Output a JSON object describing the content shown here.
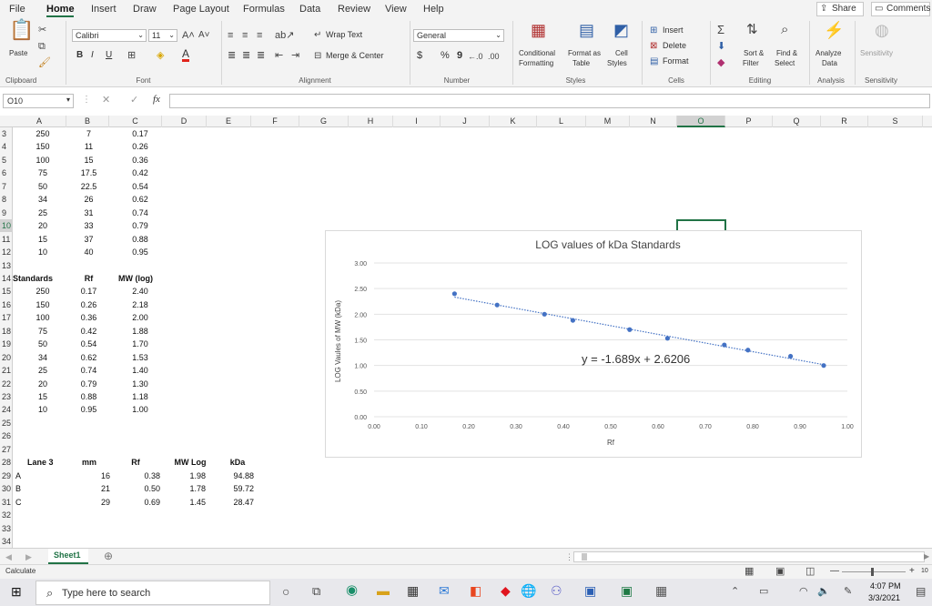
{
  "menu": {
    "tabs": [
      "File",
      "Home",
      "Insert",
      "Draw",
      "Page Layout",
      "Formulas",
      "Data",
      "Review",
      "View",
      "Help"
    ],
    "share_label": "Share",
    "comments_label": "Comments"
  },
  "ribbon": {
    "clipboard": {
      "paste": "Paste",
      "label": "Clipboard"
    },
    "font": {
      "name": "Calibri",
      "size": "11",
      "label": "Font",
      "bold": "B",
      "italic": "I",
      "underline": "U"
    },
    "alignment": {
      "wrap_text": "Wrap Text",
      "merge_center": "Merge & Center",
      "label": "Alignment"
    },
    "number": {
      "format": "General",
      "currency": "$",
      "percent": "%",
      "comma": "9",
      "label": "Number"
    },
    "styles": {
      "conditional": "Conditional",
      "formatting": "Formatting",
      "format_as": "Format as",
      "table": "Table",
      "cell": "Cell",
      "styles_btn": "Styles",
      "label": "Styles"
    },
    "cells": {
      "insert": "Insert",
      "delete": "Delete",
      "format": "Format",
      "label": "Cells"
    },
    "editing": {
      "sort_filter_1": "Sort &",
      "sort_filter_2": "Filter",
      "find_select_1": "Find &",
      "find_select_2": "Select",
      "label": "Editing"
    },
    "analysis": {
      "analyze_1": "Analyze",
      "analyze_2": "Data",
      "label": "Analysis"
    },
    "sensitivity": {
      "btn": "Sensitivity",
      "label": "Sensitivity"
    }
  },
  "formula_bar": {
    "name_box": "O10",
    "fx": "fx",
    "content": ""
  },
  "columns": [
    "A",
    "B",
    "C",
    "D",
    "E",
    "F",
    "G",
    "H",
    "I",
    "J",
    "K",
    "L",
    "M",
    "N",
    "O",
    "P",
    "Q",
    "R",
    "S"
  ],
  "rows": [
    "3",
    "4",
    "5",
    "6",
    "7",
    "8",
    "9",
    "10",
    "11",
    "12",
    "13",
    "14",
    "15",
    "16",
    "17",
    "18",
    "19",
    "20",
    "21",
    "22",
    "23",
    "24",
    "25",
    "26",
    "27",
    "28",
    "29",
    "30",
    "31",
    "32",
    "33",
    "34"
  ],
  "table1": [
    [
      "250",
      "7",
      "0.17"
    ],
    [
      "150",
      "11",
      "0.26"
    ],
    [
      "100",
      "15",
      "0.36"
    ],
    [
      "75",
      "17.5",
      "0.42"
    ],
    [
      "50",
      "22.5",
      "0.54"
    ],
    [
      "34",
      "26",
      "0.62"
    ],
    [
      "25",
      "31",
      "0.74"
    ],
    [
      "20",
      "33",
      "0.79"
    ],
    [
      "15",
      "37",
      "0.88"
    ],
    [
      "10",
      "40",
      "0.95"
    ]
  ],
  "table2": {
    "headers": [
      "Standards",
      "Rf",
      "MW (log)"
    ],
    "rows": [
      [
        "250",
        "0.17",
        "2.40"
      ],
      [
        "150",
        "0.26",
        "2.18"
      ],
      [
        "100",
        "0.36",
        "2.00"
      ],
      [
        "75",
        "0.42",
        "1.88"
      ],
      [
        "50",
        "0.54",
        "1.70"
      ],
      [
        "34",
        "0.62",
        "1.53"
      ],
      [
        "25",
        "0.74",
        "1.40"
      ],
      [
        "20",
        "0.79",
        "1.30"
      ],
      [
        "15",
        "0.88",
        "1.18"
      ],
      [
        "10",
        "0.95",
        "1.00"
      ]
    ]
  },
  "table3": {
    "headers": [
      "Lane 3",
      "mm",
      "Rf",
      "MW Log",
      "kDa"
    ],
    "rows": [
      [
        "A",
        "16",
        "0.38",
        "1.98",
        "94.88"
      ],
      [
        "B",
        "21",
        "0.50",
        "1.78",
        "59.72"
      ],
      [
        "C",
        "29",
        "0.69",
        "1.45",
        "28.47"
      ]
    ]
  },
  "chart_data": {
    "type": "scatter",
    "title": "LOG values of kDa Standards",
    "xlabel": "Rf",
    "ylabel": "LOG Vaules of MW (kDa)",
    "xlim": [
      0,
      1
    ],
    "ylim": [
      0,
      3
    ],
    "x_ticks": [
      "0.00",
      "0.10",
      "0.20",
      "0.30",
      "0.40",
      "0.50",
      "0.60",
      "0.70",
      "0.80",
      "0.90",
      "1.00"
    ],
    "y_ticks": [
      "0.00",
      "0.50",
      "1.00",
      "1.50",
      "2.00",
      "2.50",
      "3.00"
    ],
    "x": [
      0.17,
      0.26,
      0.36,
      0.42,
      0.54,
      0.62,
      0.74,
      0.79,
      0.88,
      0.95
    ],
    "y": [
      2.4,
      2.18,
      2.0,
      1.88,
      1.7,
      1.53,
      1.4,
      1.3,
      1.18,
      1.0
    ],
    "trendline": {
      "slope": -1.689,
      "intercept": 2.6206,
      "x_range": [
        0.17,
        0.95
      ],
      "label": "y = -1.689x + 2.6206"
    },
    "grid": true,
    "colors": {
      "point": "#4472c4",
      "trend": "#4472c4"
    }
  },
  "sheet": {
    "tab": "Sheet1"
  },
  "status": {
    "text": "Calculate",
    "zoom_plus": "+",
    "zoom_pct": "10"
  },
  "taskbar": {
    "search_placeholder": "Type here to search",
    "time": "4:07 PM",
    "date": "3/3/2021"
  },
  "colors": {
    "accent": "#217346",
    "selection": "#217346"
  }
}
